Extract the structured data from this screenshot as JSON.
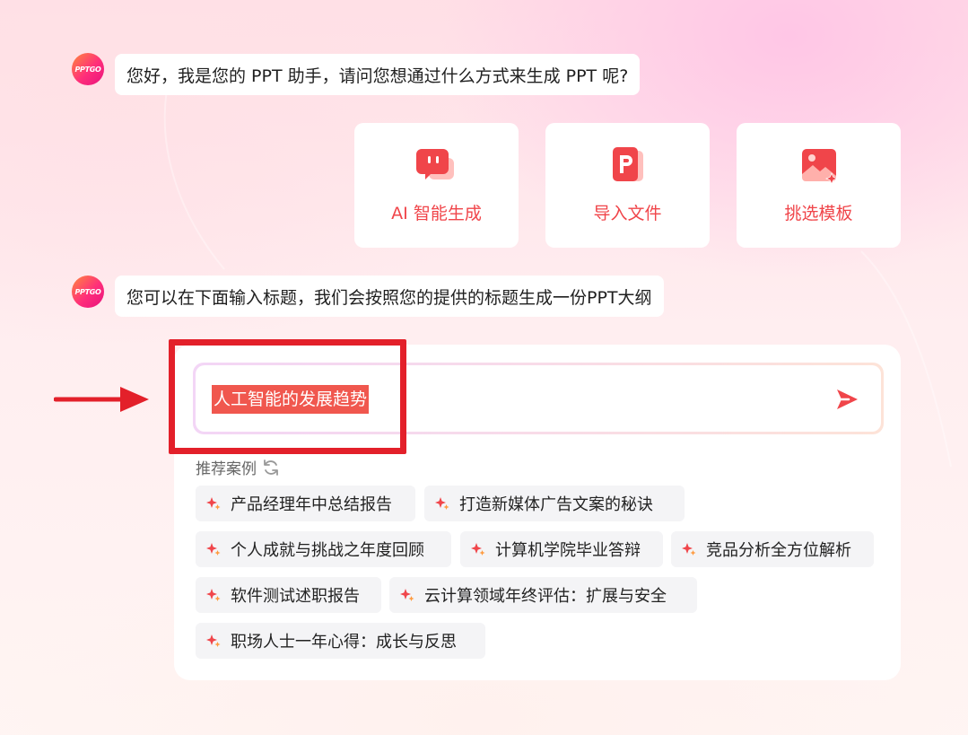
{
  "avatar": {
    "text": "PPTGO"
  },
  "messages": {
    "greeting": "您好，我是您的 PPT 助手，请问您想通过什么方式来生成 PPT 呢?",
    "instruction": "您可以在下面输入标题，我们会按照您的提供的标题生成一份PPT大纲"
  },
  "options": {
    "ai_generate": "AI 智能生成",
    "import_file": "导入文件",
    "pick_template": "挑选模板"
  },
  "input": {
    "value": "人工智能的发展趋势"
  },
  "recommend": {
    "title": "推荐案例",
    "chips": [
      "产品经理年中总结报告",
      "打造新媒体广告文案的秘诀",
      "个人成就与挑战之年度回顾",
      "计算机学院毕业答辩",
      "竞品分析全方位解析",
      "软件测试述职报告",
      "云计算领域年终评估：扩展与安全",
      "职场人士一年心得：成长与反思"
    ]
  },
  "colors": {
    "accent": "#f0454a",
    "annotation_red": "#e3202a",
    "highlight": "#f0574e"
  }
}
